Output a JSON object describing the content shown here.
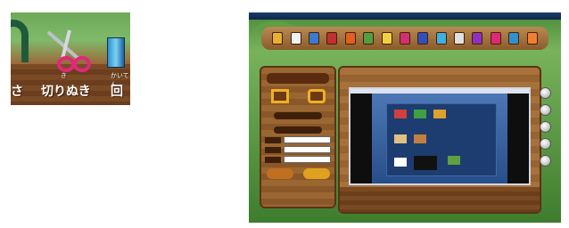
{
  "zoom_toolbar": {
    "labels": [
      "さ",
      "切りぬき",
      "回"
    ],
    "ruby": [
      "き",
      "かいてん"
    ],
    "icons": [
      "tree-icon",
      "scissors-icon",
      "book-icon"
    ]
  },
  "app": {
    "toolbar_icons": [
      "folder-icon",
      "pencil-icon",
      "crown-icon",
      "stamp-icon",
      "stamp-icon",
      "frame-icon",
      "image-icon",
      "image-icon",
      "color-icon",
      "palette-icon",
      "text-icon",
      "rotate-icon",
      "scissors-icon",
      "tool-icon",
      "tool-icon"
    ],
    "colors": {
      "accent": "#f0b020",
      "wood": "#9a6632",
      "canvas": "#284e8a"
    }
  }
}
